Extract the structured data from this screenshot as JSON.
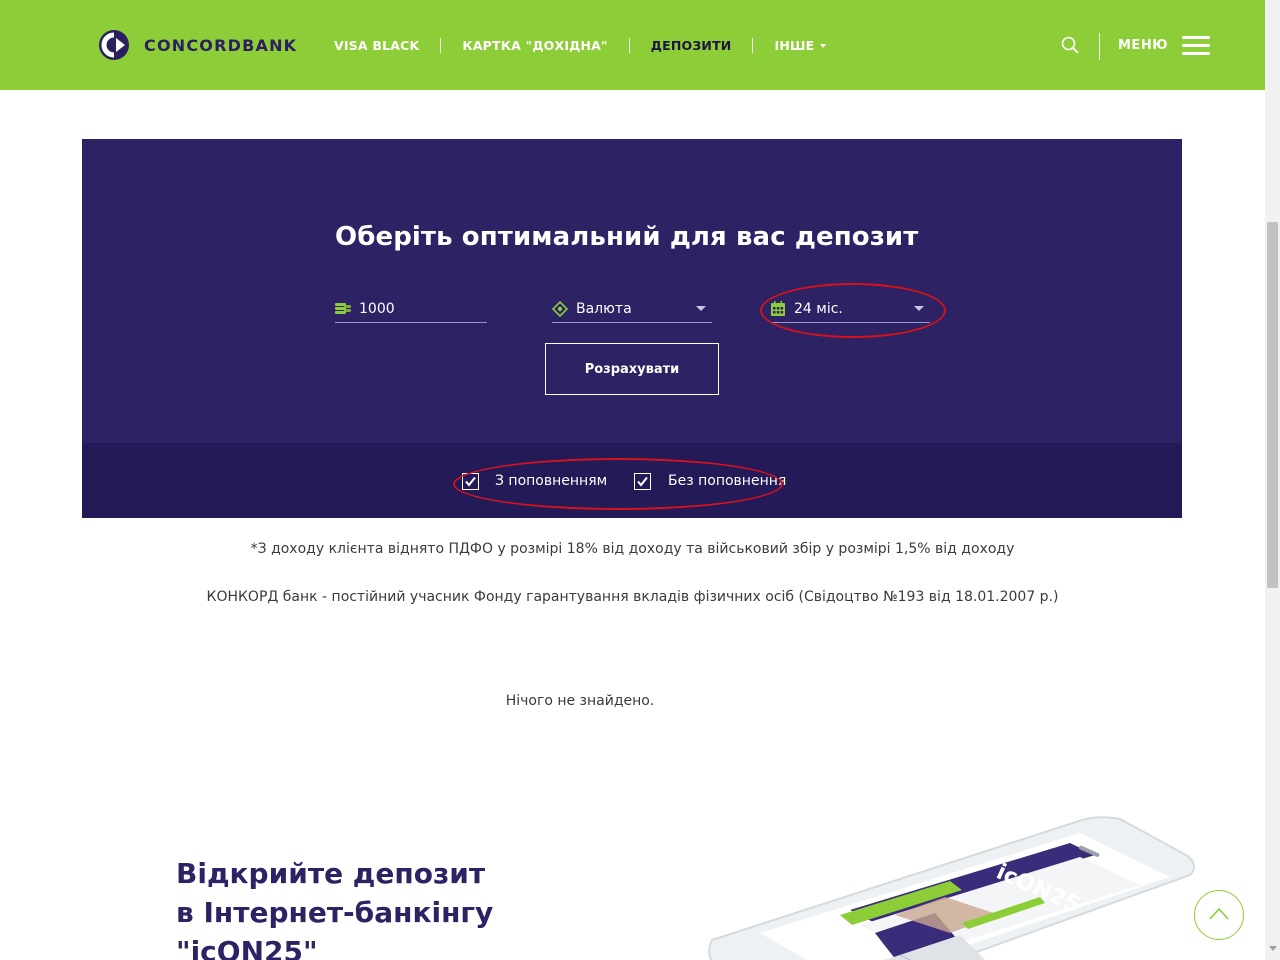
{
  "header": {
    "logo_text_part1": "CONCORD",
    "logo_text_part2": "BANK",
    "nav": [
      {
        "label": "VISA BLACK"
      },
      {
        "label": "КАРТКА \"ДОХІДНА\""
      },
      {
        "label": "ДЕПОЗИТИ"
      },
      {
        "label": "ІНШЕ"
      }
    ],
    "menu_label": "МЕНЮ",
    "accent_color": "#8dce38"
  },
  "calculator": {
    "title": "Оберіть оптимальний для вас депозит",
    "amount_value": "1000",
    "currency_value": "Валюта",
    "term_value": "24 міс.",
    "button_label": "Розрахувати",
    "checkbox_1_label": "З поповненням",
    "checkbox_1_checked": true,
    "checkbox_2_label": "Без поповнення",
    "checkbox_2_checked": true,
    "panel_color": "#2c2264"
  },
  "notes": {
    "tax": "*З доходу клієнта віднято ПДФО у розмірі 18% від доходу та військовий збір у розмірі 1,5% від доходу",
    "guarantee": "КОНКОРД банк - постійний учасник Фонду гарантування вкладів фізичних осіб (Свідоцтво №193 від 18.01.2007 р.)",
    "empty_result": "Нічого не знайдено."
  },
  "promo": {
    "title_line1": "Відкрийте депозит",
    "title_line2": "в Інтернет-банкінгу",
    "title_line3": "\"icON25\"",
    "phone_screen_brand": "icON25"
  },
  "icons": [
    "logo-icon",
    "search-icon",
    "hamburger-icon",
    "coins-icon",
    "currency-icon",
    "calendar-icon",
    "checkmark-icon",
    "chevron-up-icon"
  ]
}
